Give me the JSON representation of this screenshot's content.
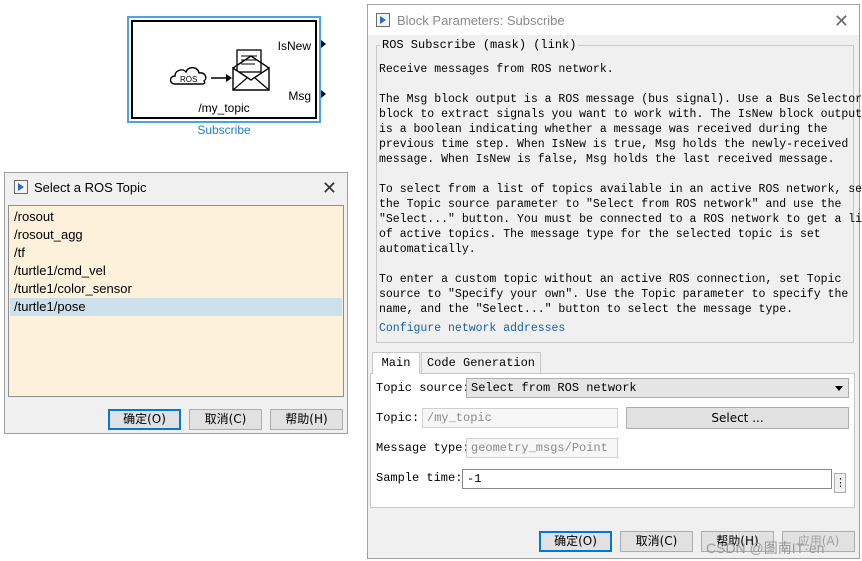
{
  "block": {
    "icon_label": "ROS",
    "port_isnew": "IsNew",
    "port_msg": "Msg",
    "topic": "/my_topic",
    "name": "Subscribe"
  },
  "topic_dialog": {
    "title": "Select a ROS Topic",
    "topics": [
      "/rosout",
      "/rosout_agg",
      "/tf",
      "/turtle1/cmd_vel",
      "/turtle1/color_sensor",
      "/turtle1/pose"
    ],
    "selected_topic": "/turtle1/pose",
    "ok_label": "确定(O)",
    "cancel_label": "取消(C)",
    "help_label": "帮助(H)"
  },
  "params": {
    "title": "Block Parameters: Subscribe",
    "mask_legend": "ROS Subscribe (mask) (link)",
    "description": [
      "Receive messages from ROS network.",
      "The Msg block output is a ROS message (bus signal). Use a Bus Selector\nblock to extract signals you want to work with. The IsNew block output\nis a boolean indicating whether a message was received during the\nprevious time step. When IsNew is true, Msg holds the newly-received\nmessage. When IsNew is false, Msg holds the last received message.",
      "To select from a list of topics available in an active ROS network, set\nthe Topic source parameter to \"Select from ROS network\" and use the\n\"Select...\" button. You must be connected to a ROS network to get a list\nof active topics. The message type for the selected topic is set\nautomatically.",
      "To enter a custom topic without an active ROS connection, set Topic\nsource to \"Specify your own\". Use the Topic parameter to specify the\nname, and the \"Select...\" button to select the message type."
    ],
    "configure_link": "Configure network addresses",
    "tabs": [
      "Main",
      "Code Generation"
    ],
    "topic_source_label": "Topic source:",
    "topic_source_value": "Select from ROS network",
    "topic_label": "Topic:",
    "topic_value": "/my_topic",
    "select_button": "Select ...",
    "msg_type_label": "Message type:",
    "msg_type_value": "geometry_msgs/Point",
    "sample_time_label": "Sample time:",
    "sample_time_value": "-1",
    "sample_more": "⋮",
    "ok_label": "确定(O)",
    "cancel_label": "取消(C)",
    "help_label": "帮助(H)",
    "apply_label": "应用(A)"
  },
  "watermark": "CSDN @图南IT·en"
}
